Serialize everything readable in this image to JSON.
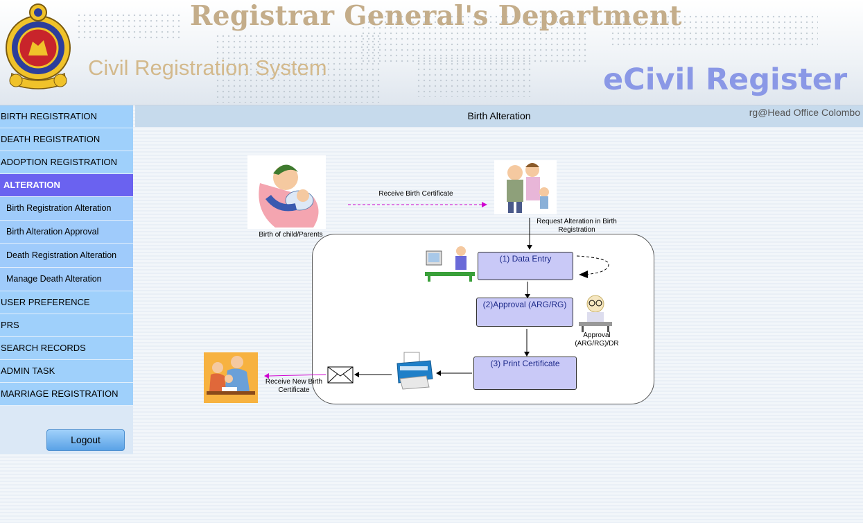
{
  "header": {
    "department_title": "Registrar General's Department",
    "system_title": "Civil Registration System",
    "app_title": "eCivil Register"
  },
  "sidebar": {
    "items": [
      {
        "label": "BIRTH REGISTRATION"
      },
      {
        "label": "DEATH REGISTRATION"
      },
      {
        "label": "ADOPTION REGISTRATION"
      },
      {
        "label": "ALTERATION",
        "active": true
      },
      {
        "label": "Birth Registration Alteration",
        "sub": true
      },
      {
        "label": "Birth Alteration Approval",
        "sub": true
      },
      {
        "label": "Death Registration Alteration",
        "sub": true
      },
      {
        "label": "Manage Death Alteration",
        "sub": true
      },
      {
        "label": "USER PREFERENCE"
      },
      {
        "label": "PRS"
      },
      {
        "label": "SEARCH RECORDS"
      },
      {
        "label": "ADMIN TASK"
      },
      {
        "label": "MARRIAGE REGISTRATION"
      }
    ],
    "logout_label": "Logout"
  },
  "content": {
    "page_title": "Birth Alteration",
    "user_info": "rg@Head Office Colombo"
  },
  "diagram": {
    "birth_label": "Birth of child/Parents",
    "receive_cert_label": "Receive Birth Certificate",
    "request_label_1": "Request Alteration in Birth",
    "request_label_2": "Registration",
    "step1": "(1) Data Entry",
    "step2": "(2)Approval (ARG/RG)",
    "step3": "(3) Print Certificate",
    "approval_label_1": "Approval",
    "approval_label_2": "(ARG/RG)/DR",
    "receive_new_label_1": "Receive New Birth",
    "receive_new_label_2": "Certificate"
  },
  "colors": {
    "sidebar_item": "#9fd0fb",
    "sidebar_active": "#6a62f0",
    "step_fill": "#c9c9f7",
    "arrow_magenta": "#d000d0"
  }
}
